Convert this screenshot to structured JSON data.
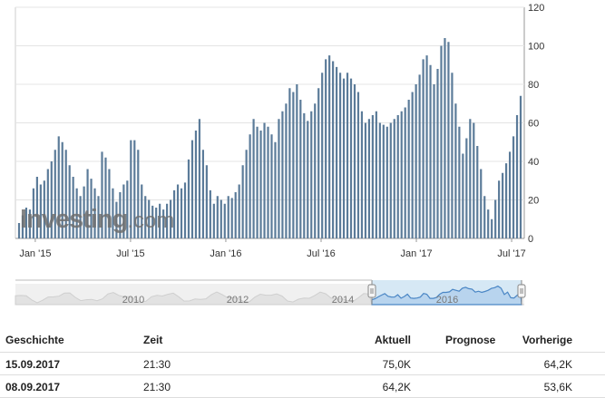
{
  "colors": {
    "bar": "#5b7b99",
    "bar_dark": "#4a6b8c",
    "grid": "#e4e4e4",
    "nav_fill": "#d6e8f5",
    "nav_line": "#4a86c5",
    "nav_bg": "#f0f0f0"
  },
  "logo": {
    "text": "Investing",
    "suffix": ".com"
  },
  "chart_data": {
    "type": "bar",
    "title": "",
    "xlabel": "",
    "ylabel": "",
    "ylim": [
      0,
      120
    ],
    "yticks": [
      0,
      20,
      40,
      60,
      80,
      100,
      120
    ],
    "x_tick_labels": [
      "Jan '15",
      "Jul '15",
      "Jan '16",
      "Jul '16",
      "Jan '17",
      "Jul '17"
    ],
    "grid": true,
    "values": [
      8,
      12,
      16,
      15,
      26,
      32,
      28,
      30,
      36,
      40,
      46,
      53,
      50,
      46,
      38,
      32,
      26,
      22,
      27,
      36,
      31,
      26,
      22,
      45,
      42,
      36,
      26,
      19,
      24,
      28,
      30,
      51,
      51,
      46,
      28,
      22,
      20,
      17,
      16,
      18,
      15,
      18,
      20,
      25,
      28,
      26,
      29,
      41,
      51,
      56,
      62,
      46,
      38,
      25,
      18,
      22,
      20,
      18,
      22,
      21,
      24,
      28,
      38,
      46,
      54,
      62,
      58,
      56,
      60,
      58,
      54,
      50,
      62,
      66,
      70,
      78,
      76,
      80,
      72,
      65,
      61,
      66,
      70,
      78,
      86,
      93,
      95,
      92,
      89,
      86,
      83,
      86,
      83,
      80,
      76,
      66,
      60,
      62,
      64,
      66,
      60,
      59,
      58,
      60,
      62,
      64,
      66,
      68,
      72,
      76,
      80,
      85,
      93,
      95,
      90,
      80,
      88,
      100,
      104,
      102,
      86,
      70,
      58,
      44,
      52,
      62,
      60,
      48,
      36,
      22,
      15,
      10,
      20,
      30,
      34,
      39,
      45,
      53,
      64,
      74
    ],
    "navigator": {
      "type": "area",
      "labels": [
        "2010",
        "2012",
        "2014",
        "2016"
      ],
      "selected_range": [
        "Jan '15",
        "Sep '17"
      ]
    }
  },
  "history": {
    "headers": {
      "date": "Geschichte",
      "time": "Zeit",
      "actual": "Aktuell",
      "forecast": "Prognose",
      "previous": "Vorherige"
    },
    "rows": [
      {
        "date": "15.09.2017",
        "time": "21:30",
        "actual": "75,0K",
        "forecast": "",
        "previous": "64,2K"
      },
      {
        "date": "08.09.2017",
        "time": "21:30",
        "actual": "64,2K",
        "forecast": "",
        "previous": "53,6K"
      }
    ]
  }
}
